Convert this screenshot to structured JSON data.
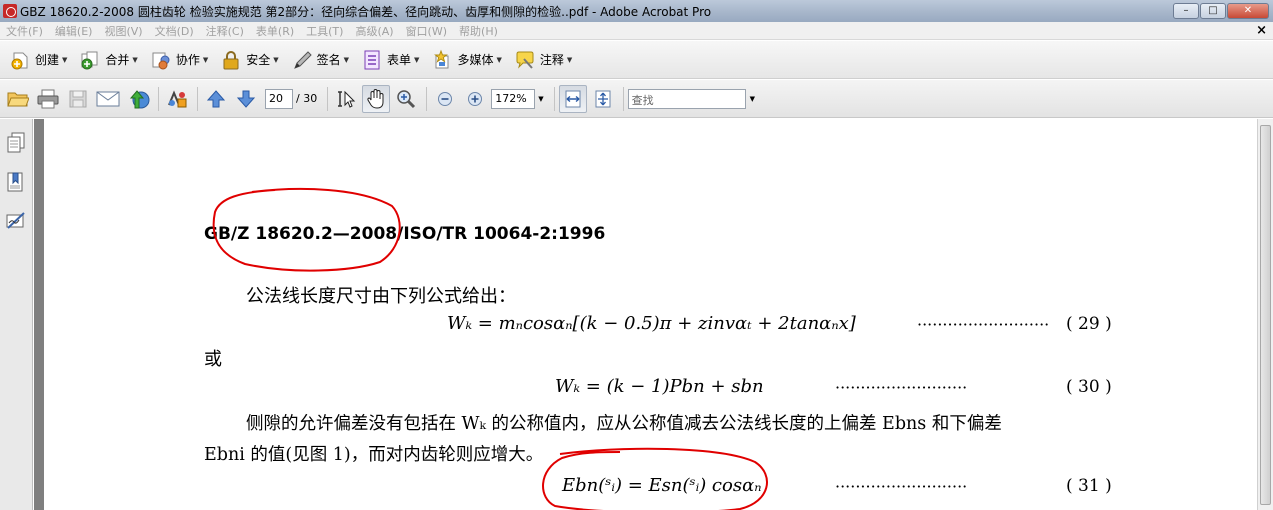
{
  "window": {
    "title": "GBZ 18620.2-2008 圆柱齿轮 检验实施规范 第2部分：径向综合偏差、径向跳动、齿厚和侧隙的检验..pdf - Adobe Acrobat Pro",
    "min_label": "–",
    "max_label": "□",
    "close_label": "✕"
  },
  "menu": {
    "items": [
      "文件(F)",
      "编辑(E)",
      "视图(V)",
      "文档(D)",
      "注释(C)",
      "表单(R)",
      "工具(T)",
      "高级(A)",
      "窗口(W)",
      "帮助(H)"
    ],
    "close_doc": "×"
  },
  "toolbar_tasks": [
    {
      "label": "创建",
      "icon": "create-icon"
    },
    {
      "label": "合并",
      "icon": "combine-icon"
    },
    {
      "label": "协作",
      "icon": "collaborate-icon"
    },
    {
      "label": "安全",
      "icon": "lock-icon"
    },
    {
      "label": "签名",
      "icon": "pen-icon"
    },
    {
      "label": "表单",
      "icon": "form-icon"
    },
    {
      "label": "多媒体",
      "icon": "multimedia-icon"
    },
    {
      "label": "注释",
      "icon": "comment-icon"
    }
  ],
  "navigation": {
    "current_page": "20",
    "total_pages": "/ 30",
    "zoom": "172%",
    "find_placeholder": "查找"
  },
  "document": {
    "header": "GB/Z 18620.2—2008/ISO/TR 10064-2:1996",
    "line1": "公法线长度尺寸由下列公式给出：",
    "formula29": "W",
    "formula29_text": "Wₖ = mₙcosαₙ[(k − 0.5)π + zinvαₜ + 2tanαₙx]",
    "eq29": "( 29 )",
    "or": "或",
    "formula30_text": "Wₖ = (k − 1)Pbn + sbn",
    "eq30": "( 30 )",
    "para2_line1": "侧隙的允许偏差没有包括在 Wₖ 的公称值内，应从公称值减去公法线长度的上偏差 Ebns 和下偏差",
    "para2_line2": "Ebni 的值(见图 1)，而对内齿轮则应增大。",
    "formula31_text": "Ebn(ˢᵢ) = Esn(ˢᵢ) cosαₙ",
    "eq31": "( 31 )",
    "dots": "··························"
  },
  "colors": {
    "annotation_red": "#e00000",
    "titlebar": "#a9b8cc"
  }
}
